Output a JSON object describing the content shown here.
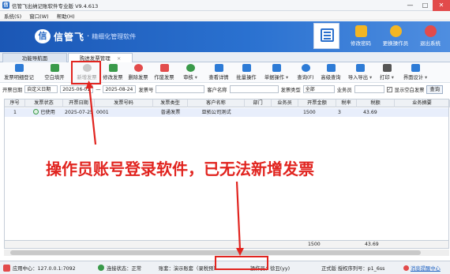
{
  "window": {
    "title": "信管飞出纳记账软件专业版 V9.4.613",
    "controls": [
      "—",
      "□",
      "✕"
    ]
  },
  "menu": [
    "系统(S)",
    "窗口(W)",
    "帮助(H)"
  ],
  "banner": {
    "brand": "信管飞",
    "slogan": "精细化管理软件",
    "actions": [
      {
        "label": "修改密码",
        "icon": "lock-icon",
        "color": "#f3b624"
      },
      {
        "label": "更换操作员",
        "icon": "users-icon",
        "color": "#f3b624"
      },
      {
        "label": "退出系统",
        "icon": "exit-icon",
        "color": "#e24b4b"
      }
    ]
  },
  "tabs": [
    "功能导航面",
    "购进发票管理"
  ],
  "toolbar": [
    {
      "label": "发票明细登记",
      "color": "#2d7bd6",
      "disabled": false
    },
    {
      "label": "空白填开",
      "color": "#3a9a4a",
      "disabled": false
    },
    {
      "label": "新增发票",
      "color": "#c9c9c9",
      "disabled": true
    },
    {
      "label": "修改发票",
      "color": "#3a9a4a",
      "disabled": false
    },
    {
      "label": "删除发票",
      "color": "#e24b4b",
      "disabled": false
    },
    {
      "label": "作废发票",
      "color": "#e24b4b",
      "disabled": false
    },
    {
      "label": "审核",
      "color": "#3a9a4a",
      "disabled": false
    },
    {
      "label": "查看详情",
      "color": "#2d7bd6",
      "disabled": false
    },
    {
      "label": "批量操作",
      "color": "#2d7bd6",
      "disabled": false
    },
    {
      "label": "单据操作",
      "color": "#2d7bd6",
      "disabled": false
    },
    {
      "label": "查询(F)",
      "color": "#2d7bd6",
      "disabled": false
    },
    {
      "label": "高级查询",
      "color": "#2d7bd6",
      "disabled": false
    },
    {
      "label": "导入导出",
      "color": "#2d7bd6",
      "disabled": false
    },
    {
      "label": "打印",
      "color": "#555555",
      "disabled": false
    },
    {
      "label": "界面设计",
      "color": "#2d7bd6",
      "disabled": false
    }
  ],
  "filters": {
    "date_label": "开票日期",
    "date_mode": "自定义日期",
    "date_from": "2025-06-01",
    "date_to": "2025-08-24",
    "invoice_no_label": "发票号",
    "customer_label": "客户名称",
    "invoice_type_label": "发票类型",
    "invoice_type_value": "全部",
    "clerk_label": "业务员",
    "show_void_label": "显示空白发票",
    "query_btn": "查询"
  },
  "table": {
    "headers": [
      "序号",
      "发票状态",
      "开票日期",
      "发票号码",
      "发票类型",
      "客户名称",
      "部门",
      "业务员",
      "开票金额",
      "税率",
      "税额",
      "业务摘要"
    ],
    "rows": [
      [
        "1",
        "已使用",
        "2025-07-25",
        "0001",
        "普通发票",
        "亚拓公司测试",
        "",
        "",
        "1500",
        "3",
        "43.69",
        ""
      ]
    ],
    "totals": {
      "amount": "1500",
      "tax": "43.69"
    }
  },
  "annotation": "操作员账号登录软件，已无法新增发票",
  "statusbar": {
    "server": "应用中心：127.0.0.1:7092",
    "conn": "连接状态：正常",
    "account": "账套：演示账套（录税预）",
    "operator": "操作员：徐丑(yy)",
    "license": "正式版 授权序列号：p1_6ss",
    "reminder": "消息提醒中心"
  }
}
